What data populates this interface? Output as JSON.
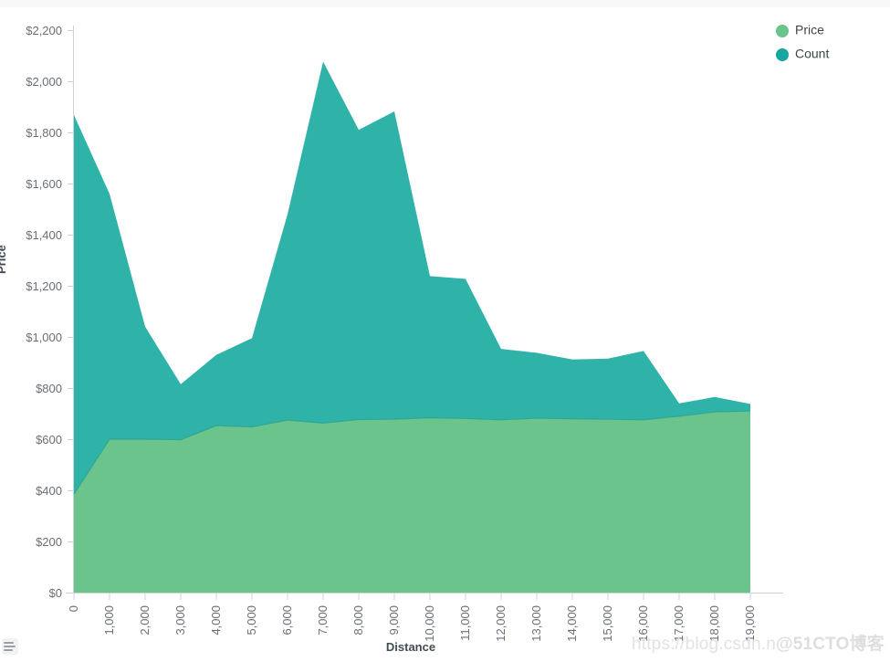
{
  "chart_data": {
    "type": "area",
    "stacked": true,
    "title": "",
    "xlabel": "Distance",
    "ylabel": "Price",
    "x": [
      0,
      1000,
      2000,
      3000,
      4000,
      5000,
      6000,
      7000,
      8000,
      9000,
      10000,
      11000,
      12000,
      13000,
      14000,
      15000,
      16000,
      17000,
      18000,
      19000
    ],
    "xtick_labels": [
      "0",
      "1,000",
      "2,000",
      "3,000",
      "4,000",
      "5,000",
      "6,000",
      "7,000",
      "8,000",
      "9,000",
      "10,000",
      "11,000",
      "12,000",
      "13,000",
      "14,000",
      "15,000",
      "16,000",
      "17,000",
      "18,000",
      "19,000"
    ],
    "ytick_labels": [
      "$0",
      "$200",
      "$400",
      "$600",
      "$800",
      "$1,000",
      "$1,200",
      "$1,400",
      "$1,600",
      "$1,800",
      "$2,000",
      "$2,200"
    ],
    "ytick_values": [
      0,
      200,
      400,
      600,
      800,
      1000,
      1200,
      1400,
      1600,
      1800,
      2000,
      2200
    ],
    "ylim": [
      0,
      2200
    ],
    "xlim": [
      0,
      19000
    ],
    "grid": false,
    "legend_position": "top-right",
    "series": [
      {
        "name": "Price",
        "color": "#6ac48b",
        "values": [
          385,
          600,
          600,
          598,
          653,
          648,
          675,
          663,
          677,
          678,
          684,
          681,
          676,
          682,
          680,
          678,
          676,
          690,
          707,
          710
        ]
      },
      {
        "name": "Count",
        "color": "#2fb3a8",
        "cumulative_top": [
          1868,
          1560,
          1040,
          815,
          930,
          995,
          1480,
          2077,
          1810,
          1882,
          1238,
          1227,
          953,
          938,
          912,
          915,
          945,
          740,
          765,
          738
        ]
      }
    ]
  },
  "legend": {
    "items": [
      {
        "label": "Price",
        "color": "#6ac48b"
      },
      {
        "label": "Count",
        "color": "#2fb3a8"
      }
    ]
  },
  "axes": {
    "x_title": "Distance",
    "y_title": "Price"
  },
  "watermark": {
    "url_text": "https://blog.csdn.n",
    "brand_text": "@51CTO博客"
  },
  "corner": {
    "icon": "list-lines-icon"
  }
}
